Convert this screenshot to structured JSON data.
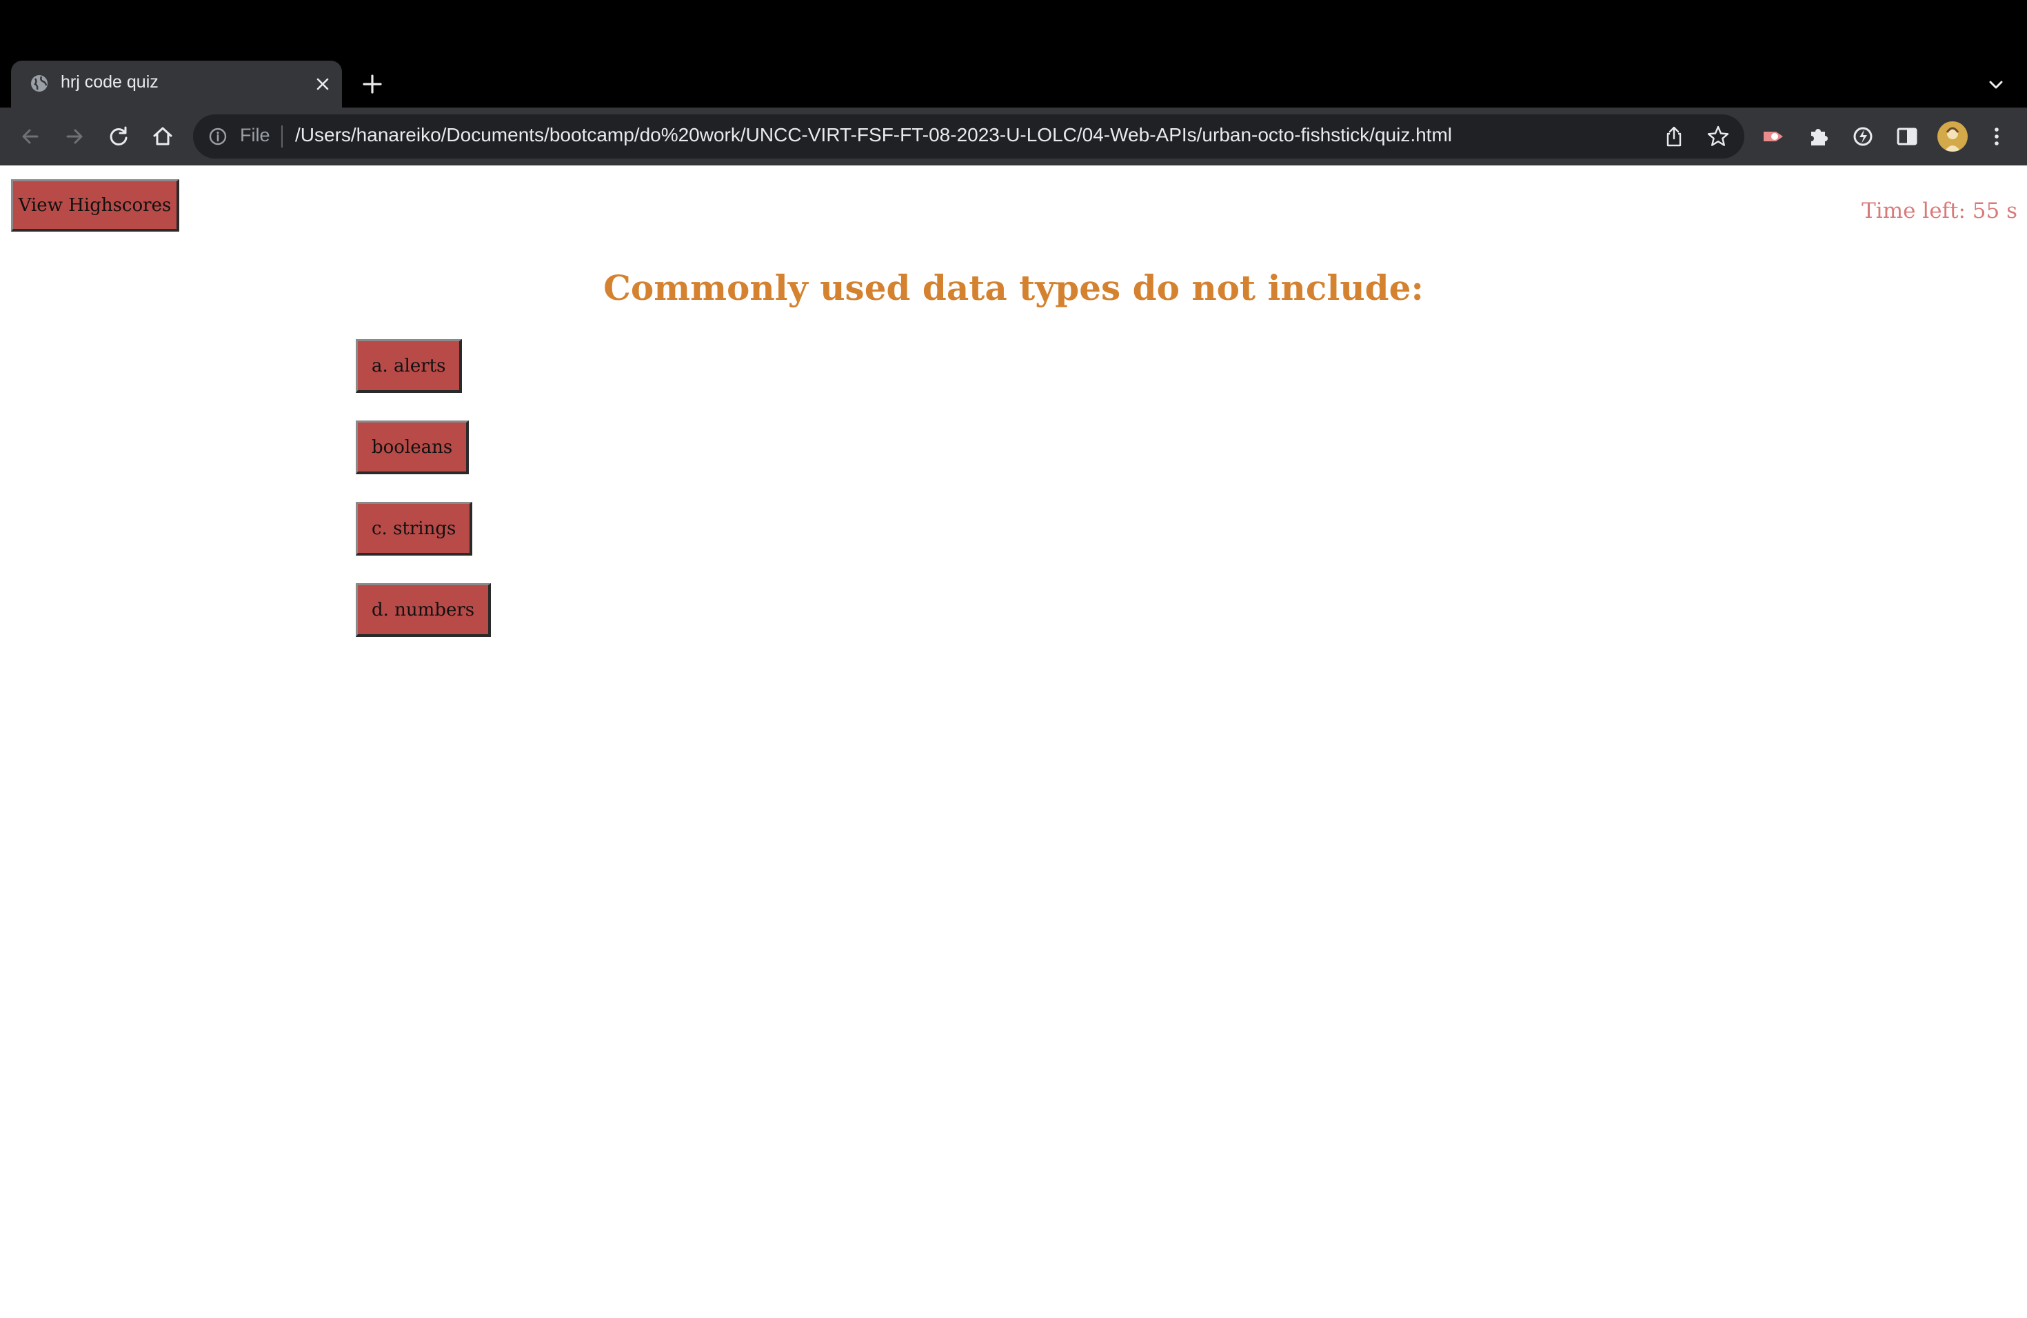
{
  "browser": {
    "tab": {
      "title": "hrj code quiz",
      "icon": "globe-icon"
    },
    "omnibox": {
      "scheme_label": "File",
      "url": "/Users/hanareiko/Documents/bootcamp/do%20work/UNCC-VIRT-FSF-FT-08-2023-U-LOLC/04-Web-APIs/urban-octo-fishstick/quiz.html"
    }
  },
  "page": {
    "highscores_label": "View Highscores",
    "timer_text": "Time left: 55 s",
    "question": "Commonly used data types do not include:",
    "answers": [
      "a. alerts",
      "booleans",
      "c. strings",
      "d. numbers"
    ]
  },
  "colors": {
    "button_bg": "#b84a48",
    "question": "#d4822f",
    "timer": "#d97a7a"
  }
}
